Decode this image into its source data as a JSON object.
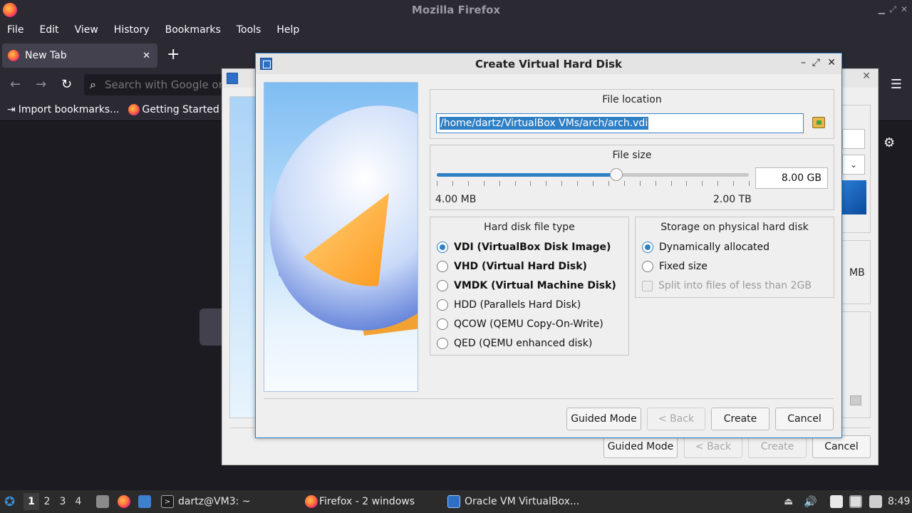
{
  "firefox": {
    "window_title": "Mozilla Firefox",
    "menu": [
      "File",
      "Edit",
      "View",
      "History",
      "Bookmarks",
      "Tools",
      "Help"
    ],
    "tab_label": "New Tab",
    "search_placeholder": "Search with Google or enter address",
    "bookmarks": [
      "Import bookmarks...",
      "Getting Started"
    ]
  },
  "bg_dialog": {
    "unit_label": "MB",
    "buttons": {
      "guided": "Guided Mode",
      "back": "< Back",
      "create": "Create",
      "cancel": "Cancel"
    }
  },
  "dialog": {
    "title": "Create Virtual Hard Disk",
    "file_location": {
      "title": "File location",
      "path": "/home/dartz/VirtualBox VMs/arch/arch.vdi"
    },
    "file_size": {
      "title": "File size",
      "value": "8.00 GB",
      "min_label": "4.00 MB",
      "max_label": "2.00 TB",
      "slider_fraction": 0.575
    },
    "file_type": {
      "title": "Hard disk file type",
      "options": [
        {
          "label": "VDI (VirtualBox Disk Image)",
          "selected": true
        },
        {
          "label": "VHD (Virtual Hard Disk)",
          "selected": false
        },
        {
          "label": "VMDK (Virtual Machine Disk)",
          "selected": false
        },
        {
          "label": "HDD (Parallels Hard Disk)",
          "selected": false
        },
        {
          "label": "QCOW (QEMU Copy-On-Write)",
          "selected": false
        },
        {
          "label": "QED (QEMU enhanced disk)",
          "selected": false
        }
      ]
    },
    "storage": {
      "title": "Storage on physical hard disk",
      "options": [
        {
          "label": "Dynamically allocated",
          "selected": true
        },
        {
          "label": "Fixed size",
          "selected": false
        }
      ],
      "split_label": "Split into files of less than 2GB"
    },
    "buttons": {
      "guided": "Guided Mode",
      "back": "< Back",
      "create": "Create",
      "cancel": "Cancel"
    }
  },
  "taskbar": {
    "workspaces": [
      "1",
      "2",
      "3",
      "4"
    ],
    "terminal": "dartz@VM3: ~",
    "firefox": "Firefox - 2 windows",
    "virtualbox": "Oracle VM VirtualBox...",
    "clock": "8:49"
  },
  "colors": {
    "accent": "#2f7fc5",
    "firefox_bg": "#1c1b22",
    "dialog_bg": "#efefef"
  }
}
